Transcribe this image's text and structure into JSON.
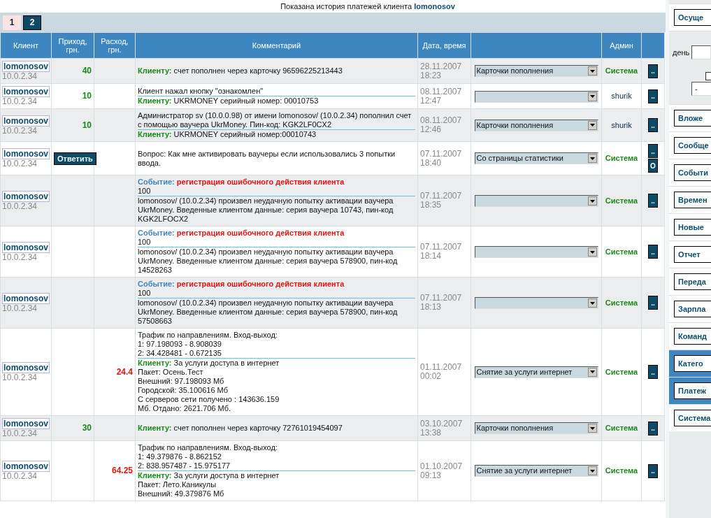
{
  "heading": {
    "text": "Показана история платежей клиента",
    "client": "lomonosov"
  },
  "pages": [
    {
      "label": "1",
      "selected": false
    },
    {
      "label": "2",
      "selected": true
    }
  ],
  "columns": [
    "Клиент",
    "Приход, грн.",
    "Расход, грн.",
    "Комментарий",
    "Дата, время"
  ],
  "admin_column": "Админ",
  "rows": [
    {
      "client": "lomonosov",
      "ip": "10.0.2.34",
      "income": "40",
      "comment": [
        {
          "kind": "client",
          "label": "Клиенту:",
          "lines": [
            "счет пополнен через карточку 96596225213443"
          ]
        }
      ],
      "date": "28.11.2007",
      "time": "18:23",
      "category": "Карточки пополнения",
      "admin": {
        "name": "Система",
        "kind": "system"
      },
      "actions": [
        ".."
      ]
    },
    {
      "client": "lomonosov",
      "ip": "10.0.2.34",
      "income": "10",
      "comment": [
        {
          "kind": "plain",
          "lines": [
            "Клиент нажал кнопку \"ознакомлен\""
          ]
        },
        {
          "kind": "client",
          "label": "Клиенту:",
          "lines": [
            "UKRMONEY серийный номер: 00010753"
          ]
        }
      ],
      "date": "08.11.2007",
      "time": "12:47",
      "admin": {
        "name": "shurik",
        "kind": "user"
      },
      "actions": [
        ".."
      ]
    },
    {
      "client": "lomonosov",
      "ip": "10.0.2.34",
      "income": "10",
      "comment": [
        {
          "kind": "plain",
          "lines": [
            "Администратор sv (10.0.0.98) от имени lomonosov/ (10.0.2.34) пополнил счет",
            "с помощью ваучера UkrMoney. Пин-код: KGK2LF0CX2"
          ]
        },
        {
          "kind": "client",
          "label": "Клиенту:",
          "lines": [
            "UKRMONEY серийный номер:00010743"
          ]
        }
      ],
      "date": "08.11.2007",
      "time": "12:46",
      "category": "Карточки пополнения",
      "admin": {
        "name": "shurik",
        "kind": "user"
      },
      "actions": [
        ".."
      ]
    },
    {
      "client": "lomonosov",
      "ip": "10.0.2.34",
      "reply": "Ответить",
      "comment": [
        {
          "kind": "plain",
          "lines": [
            "Вопрос: Как мне активировать ваучеры если использовались 3 попытки",
            "ввода."
          ]
        }
      ],
      "date": "07.11.2007",
      "time": "18:40",
      "category": "Со страницы статистики",
      "admin": {
        "name": "Система",
        "kind": "system"
      },
      "actions": [
        "..",
        "O"
      ]
    },
    {
      "client": "lomonosov",
      "ip": "10.0.2.34",
      "comment": [
        {
          "kind": "event",
          "label": "Событие:",
          "lines": [
            "регистрация ошибочного действия клиента",
            "100"
          ]
        },
        {
          "kind": "plain",
          "lines": [
            "lomonosov/ (10.0.2.34) произвел неудачную попытку активации ваучера",
            "UkrMoney. Введенные клиентом данные: серия ваучера 10743, пин-код",
            "KGK2LFOCX2"
          ]
        }
      ],
      "date": "07.11.2007",
      "time": "18:35",
      "admin": {
        "name": "Система",
        "kind": "system"
      },
      "actions": [
        ".."
      ]
    },
    {
      "client": "lomonosov",
      "ip": "10.0.2.34",
      "comment": [
        {
          "kind": "event",
          "label": "Событие:",
          "lines": [
            "регистрация ошибочного действия клиента",
            "100"
          ]
        },
        {
          "kind": "plain",
          "lines": [
            "lomonosov/ (10.0.2.34) произвел неудачную попытку активации ваучера",
            "UkrMoney. Введенные клиентом данные: серия ваучера 578900, пин-код",
            "14528263"
          ]
        }
      ],
      "date": "07.11.2007",
      "time": "18:14",
      "admin": {
        "name": "Система",
        "kind": "system"
      },
      "actions": [
        ".."
      ]
    },
    {
      "client": "lomonosov",
      "ip": "10.0.2.34",
      "comment": [
        {
          "kind": "event",
          "label": "Событие:",
          "lines": [
            "регистрация ошибочного действия клиента",
            "100"
          ]
        },
        {
          "kind": "plain",
          "lines": [
            "lomonosov/ (10.0.2.34) произвел неудачную попытку активации ваучера",
            "UkrMoney. Введенные клиентом данные: серия ваучера 578900, пин-код",
            "57508663"
          ]
        }
      ],
      "date": "07.11.2007",
      "time": "18:13",
      "admin": {
        "name": "Система",
        "kind": "system"
      },
      "actions": [
        ".."
      ]
    },
    {
      "client": "lomonosov",
      "ip": "10.0.2.34",
      "expense": "24.4",
      "comment": [
        {
          "kind": "plain",
          "lines": [
            "Трафик по направлениям. Вход-выход:",
            "1: 97.198093 - 8.908039",
            "2: 34.428481 - 0.672135"
          ]
        },
        {
          "kind": "client",
          "label": "Клиенту:",
          "lines": [
            "За услуги доступа в интернет",
            "Пакет: Осень.Тест",
            "Внешний: 97.198093 Мб",
            "Городской: 35.100616 Мб",
            "С серверов сети получено : 143636.159",
            "Мб. Отдано: 2621.706 Мб."
          ]
        }
      ],
      "date": "01.11.2007",
      "time": "00:02",
      "category": "Снятие за услуги интернет",
      "admin": {
        "name": "Система",
        "kind": "system"
      },
      "actions": [
        ".."
      ]
    },
    {
      "client": "lomonosov",
      "ip": "10.0.2.34",
      "income": "30",
      "comment": [
        {
          "kind": "client",
          "label": "Клиенту:",
          "lines": [
            "счет пополнен через карточку 72761019454097"
          ]
        }
      ],
      "date": "03.10.2007",
      "time": "13:38",
      "category": "Карточки пополнения",
      "admin": {
        "name": "Система",
        "kind": "system"
      },
      "actions": [
        ".."
      ]
    },
    {
      "client": "lomonosov",
      "ip": "10.0.2.34",
      "expense": "64.25",
      "comment": [
        {
          "kind": "plain",
          "lines": [
            "Трафик по направлениям. Вход-выход:",
            "1: 49.379876 - 8.862152",
            "2: 838.957487 - 15.975177"
          ]
        },
        {
          "kind": "client",
          "label": "Клиенту:",
          "lines": [
            "За услуги доступа в интернет",
            "Пакет: Лето.Каникулы",
            "Внешний: 49.379876 Мб"
          ]
        }
      ],
      "date": "01.10.2007",
      "time": "09:13",
      "category": "Снятие за услуги интернет",
      "admin": {
        "name": "Система",
        "kind": "system"
      },
      "actions": [
        ".."
      ]
    }
  ],
  "sidebar": {
    "top": {
      "label": "Осуще",
      "selected": false
    },
    "filter": {
      "day_label": "день",
      "checked": false,
      "period": "-"
    },
    "items": [
      {
        "label": "Вложе",
        "selected": false
      },
      {
        "label": "Сообще",
        "selected": false
      },
      {
        "label": "Событи",
        "selected": false
      },
      {
        "label": "Времен",
        "selected": false
      },
      {
        "label": "Новые",
        "selected": false
      },
      {
        "label": "Отчет",
        "selected": false
      },
      {
        "label": "Переда",
        "selected": false
      },
      {
        "label": "Зарпла",
        "selected": false
      },
      {
        "label": "Команд",
        "selected": false
      },
      {
        "label": "Катего",
        "selected": true
      },
      {
        "label": "Платеж",
        "selected": true
      },
      {
        "label": "Система",
        "selected": false
      }
    ]
  }
}
